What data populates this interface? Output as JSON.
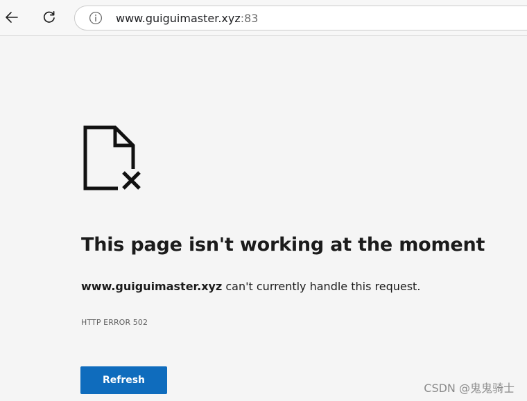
{
  "browser": {
    "url_host": "www.guiguimaster.xyz",
    "url_port": ":83",
    "icons": {
      "back": "back-arrow-icon",
      "refresh": "refresh-icon",
      "site_info": "info-icon"
    }
  },
  "error_page": {
    "icon": "document-error-icon",
    "heading": "This page isn't working at the moment",
    "message_host": "www.guiguimaster.xyz",
    "message_text": " can't currently handle this request.",
    "error_code": "HTTP ERROR 502",
    "refresh_label": "Refresh"
  },
  "watermark": {
    "text": "CSDN @鬼鬼骑士"
  },
  "colors": {
    "page_background": "#f5f5f5",
    "button_blue": "#0f6cbd",
    "text_dark": "#1b1b1b",
    "text_muted": "#5f5f5f"
  }
}
